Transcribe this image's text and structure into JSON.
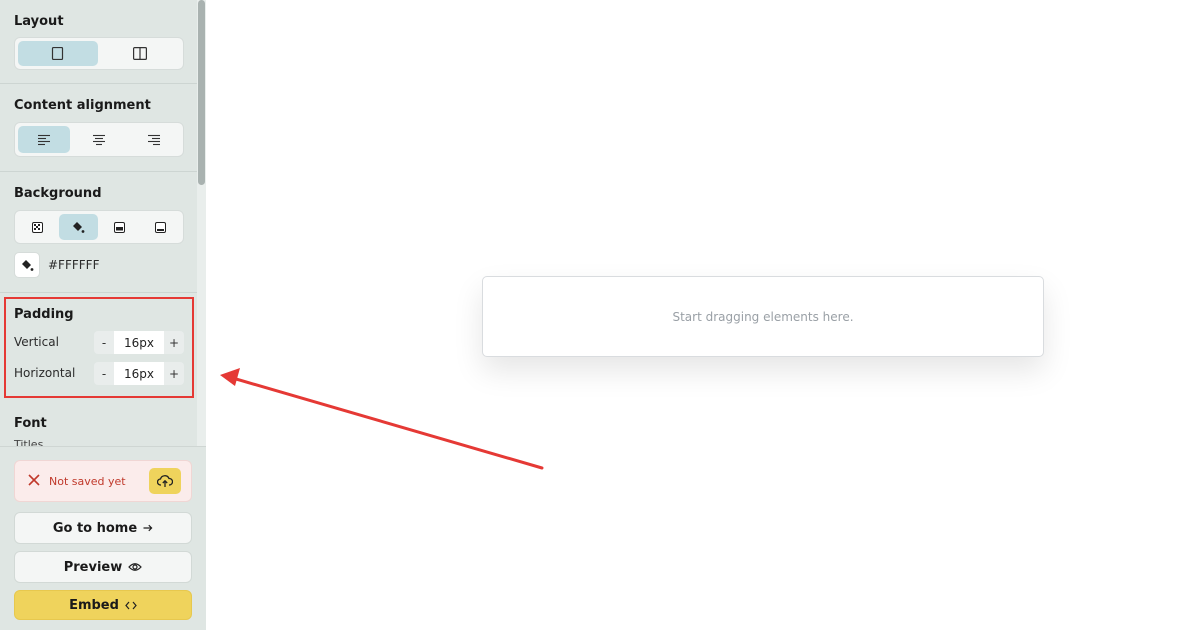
{
  "sidebar": {
    "layout": {
      "title": "Layout",
      "options": [
        "single-column-icon",
        "two-column-icon"
      ],
      "active": 0
    },
    "alignment": {
      "title": "Content alignment",
      "options": [
        "align-left-icon",
        "align-center-icon",
        "align-right-icon"
      ],
      "active": 0
    },
    "background": {
      "title": "Background",
      "options": [
        "pattern-icon",
        "paint-bucket-icon",
        "image-top-icon",
        "image-bottom-icon"
      ],
      "active": 1,
      "color_value": "#FFFFFF"
    },
    "padding": {
      "title": "Padding",
      "vertical": {
        "label": "Vertical",
        "value": "16px",
        "minus": "-",
        "plus": "+"
      },
      "horizontal": {
        "label": "Horizontal",
        "value": "16px",
        "minus": "-",
        "plus": "+"
      }
    },
    "font": {
      "title": "Font",
      "sub": "Titles"
    }
  },
  "footer": {
    "status_text": "Not saved yet",
    "go_home_label": "Go to home",
    "preview_label": "Preview",
    "embed_label": "Embed"
  },
  "canvas": {
    "placeholder": "Start dragging elements here."
  },
  "colors": {
    "accent": "#efd35c",
    "active_segment": "#c2dde3",
    "sidebar_bg": "#dfe6e3",
    "annotation": "#e53935"
  }
}
